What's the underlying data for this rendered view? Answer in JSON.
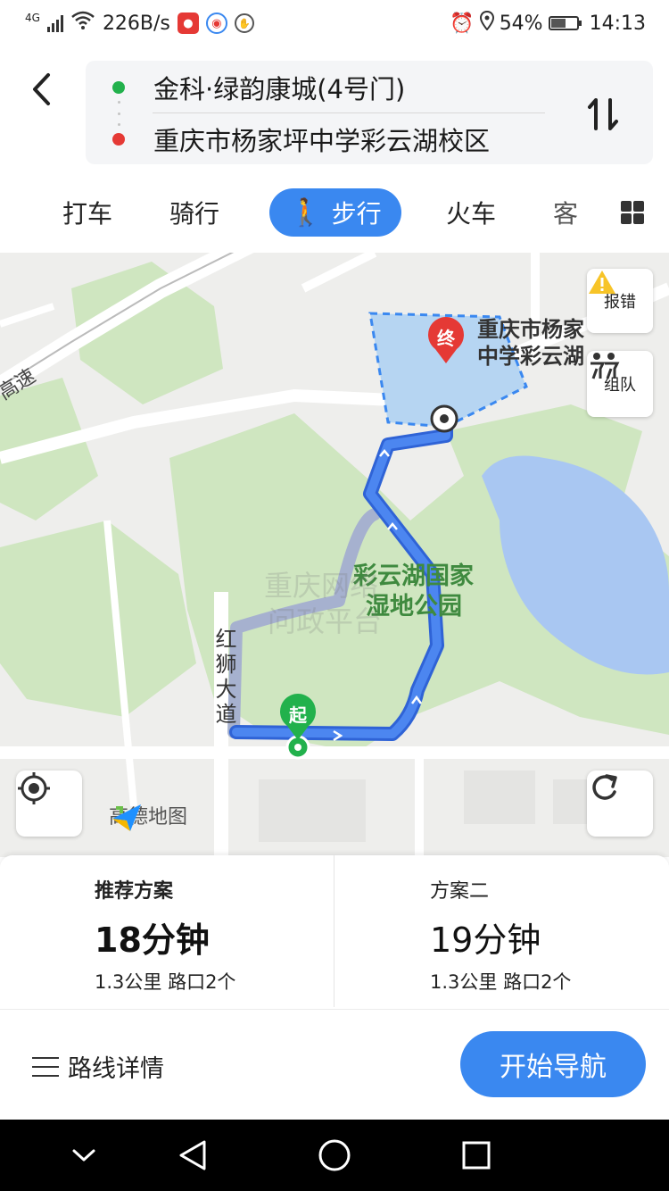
{
  "status_bar": {
    "network": "4G",
    "speed": "226B/s",
    "battery": "54%",
    "time": "14:13"
  },
  "route": {
    "origin": "金科·绿韵康城(4号门)",
    "destination": "重庆市杨家坪中学彩云湖校区",
    "origin_color": "#22b14c",
    "destination_color": "#e53935"
  },
  "tabs": {
    "items": [
      "打车",
      "骑行",
      "步行",
      "火车",
      "客"
    ],
    "active": "步行",
    "accent": "#3a88f0"
  },
  "map": {
    "labels": {
      "highway": "高速",
      "road": "红狮大道",
      "park_line1": "彩云湖国家",
      "park_line2": "湿地公园",
      "dest_line1": "重庆市杨家",
      "dest_line2": "中学彩云湖",
      "watermark_line1": "重庆网络",
      "watermark_line2": "问政平台",
      "start_marker": "起",
      "end_marker": "终"
    },
    "buttons": {
      "report": "报错",
      "team": "组队"
    },
    "logo": "高德地图"
  },
  "plans": [
    {
      "title": "推荐方案",
      "duration": "18分钟",
      "info": "1.3公里 路口2个"
    },
    {
      "title": "方案二",
      "duration": "19分钟",
      "info": "1.3公里 路口2个"
    }
  ],
  "actions": {
    "details": "路线详情",
    "navigate": "开始导航"
  }
}
